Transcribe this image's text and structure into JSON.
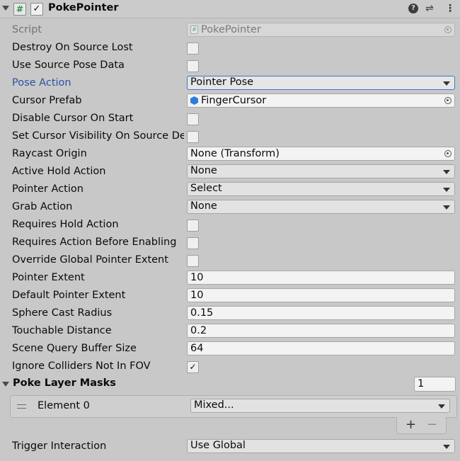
{
  "header": {
    "title": "PokePointer",
    "script_icon": "#",
    "enabled_mark": "✓",
    "help_icon": "?",
    "presets_icon": "⇌",
    "menu_icon": "⋮"
  },
  "fields": {
    "script": {
      "label": "Script",
      "value": "PokePointer"
    },
    "destroy_on_source_lost": {
      "label": "Destroy On Source Lost",
      "checked": ""
    },
    "use_source_pose_data": {
      "label": "Use Source Pose Data",
      "checked": ""
    },
    "pose_action": {
      "label": "Pose Action",
      "value": "Pointer Pose"
    },
    "cursor_prefab": {
      "label": "Cursor Prefab",
      "value": "FingerCursor"
    },
    "disable_cursor_on_start": {
      "label": "Disable Cursor On Start",
      "checked": ""
    },
    "set_cursor_visibility": {
      "label": "Set Cursor Visibility On Source Detected",
      "checked": ""
    },
    "raycast_origin": {
      "label": "Raycast Origin",
      "value": "None (Transform)"
    },
    "active_hold_action": {
      "label": "Active Hold Action",
      "value": "None"
    },
    "pointer_action": {
      "label": "Pointer Action",
      "value": "Select"
    },
    "grab_action": {
      "label": "Grab Action",
      "value": "None"
    },
    "requires_hold_action": {
      "label": "Requires Hold Action",
      "checked": ""
    },
    "requires_action_before_enabling": {
      "label": "Requires Action Before Enabling",
      "checked": ""
    },
    "override_global_pointer_extent": {
      "label": "Override Global Pointer Extent",
      "checked": ""
    },
    "pointer_extent": {
      "label": "Pointer Extent",
      "value": "10"
    },
    "default_pointer_extent": {
      "label": "Default Pointer Extent",
      "value": "10"
    },
    "sphere_cast_radius": {
      "label": "Sphere Cast Radius",
      "value": "0.15"
    },
    "touchable_distance": {
      "label": "Touchable Distance",
      "value": "0.2"
    },
    "scene_query_buffer_size": {
      "label": "Scene Query Buffer Size",
      "value": "64"
    },
    "ignore_colliders_not_in_fov": {
      "label": "Ignore Colliders Not In FOV",
      "checked": "✓"
    }
  },
  "poke_layer_masks": {
    "label": "Poke Layer Masks",
    "size": "1",
    "elements": [
      {
        "label": "Element 0",
        "value": "Mixed..."
      }
    ],
    "add_label": "+",
    "remove_label": "−"
  },
  "trigger_interaction": {
    "label": "Trigger Interaction",
    "value": "Use Global"
  }
}
